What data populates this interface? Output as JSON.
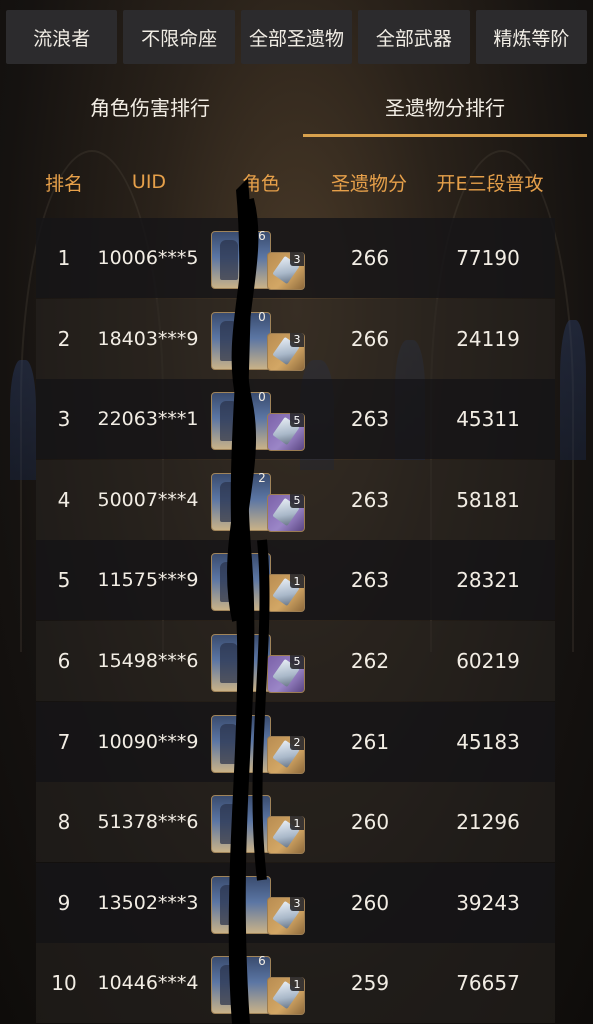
{
  "filters": [
    {
      "label": "流浪者"
    },
    {
      "label": "不限命座"
    },
    {
      "label": "全部圣遗物"
    },
    {
      "label": "全部武器"
    },
    {
      "label": "精炼等阶"
    }
  ],
  "tabs": {
    "damage_rank": "角色伤害排行",
    "artifact_rank": "圣遗物分排行"
  },
  "table": {
    "headers": {
      "rank": "排名",
      "uid": "UID",
      "character": "角色",
      "artifact_score": "圣遗物分",
      "damage": "开E三段普攻"
    },
    "rows": [
      {
        "rank": "1",
        "uid": "10006***5",
        "constellation": "6",
        "refinement": "3",
        "weapon_rarity": "gold",
        "score": "266",
        "damage": "77190"
      },
      {
        "rank": "2",
        "uid": "18403***9",
        "constellation": "0",
        "refinement": "3",
        "weapon_rarity": "gold",
        "score": "266",
        "damage": "24119"
      },
      {
        "rank": "3",
        "uid": "22063***1",
        "constellation": "0",
        "refinement": "5",
        "weapon_rarity": "purple",
        "score": "263",
        "damage": "45311"
      },
      {
        "rank": "4",
        "uid": "50007***4",
        "constellation": "2",
        "refinement": "5",
        "weapon_rarity": "purple",
        "score": "263",
        "damage": "58181"
      },
      {
        "rank": "5",
        "uid": "11575***9",
        "constellation": "0",
        "refinement": "1",
        "weapon_rarity": "gold",
        "score": "263",
        "damage": "28321"
      },
      {
        "rank": "6",
        "uid": "15498***6",
        "constellation": "",
        "refinement": "5",
        "weapon_rarity": "purple",
        "score": "262",
        "damage": "60219"
      },
      {
        "rank": "7",
        "uid": "10090***9",
        "constellation": "",
        "refinement": "2",
        "weapon_rarity": "gold",
        "score": "261",
        "damage": "45183"
      },
      {
        "rank": "8",
        "uid": "51378***6",
        "constellation": "",
        "refinement": "1",
        "weapon_rarity": "gold",
        "score": "260",
        "damage": "21296"
      },
      {
        "rank": "9",
        "uid": "13502***3",
        "constellation": "",
        "refinement": "3",
        "weapon_rarity": "gold",
        "score": "260",
        "damage": "39243"
      },
      {
        "rank": "10",
        "uid": "10446***4",
        "constellation": "6",
        "refinement": "1",
        "weapon_rarity": "gold",
        "score": "259",
        "damage": "76657"
      }
    ]
  },
  "colors": {
    "accent": "#d8a14d",
    "header_text": "#e6a04a",
    "button_bg": "#2c2b2d",
    "scribble": "#000000"
  }
}
